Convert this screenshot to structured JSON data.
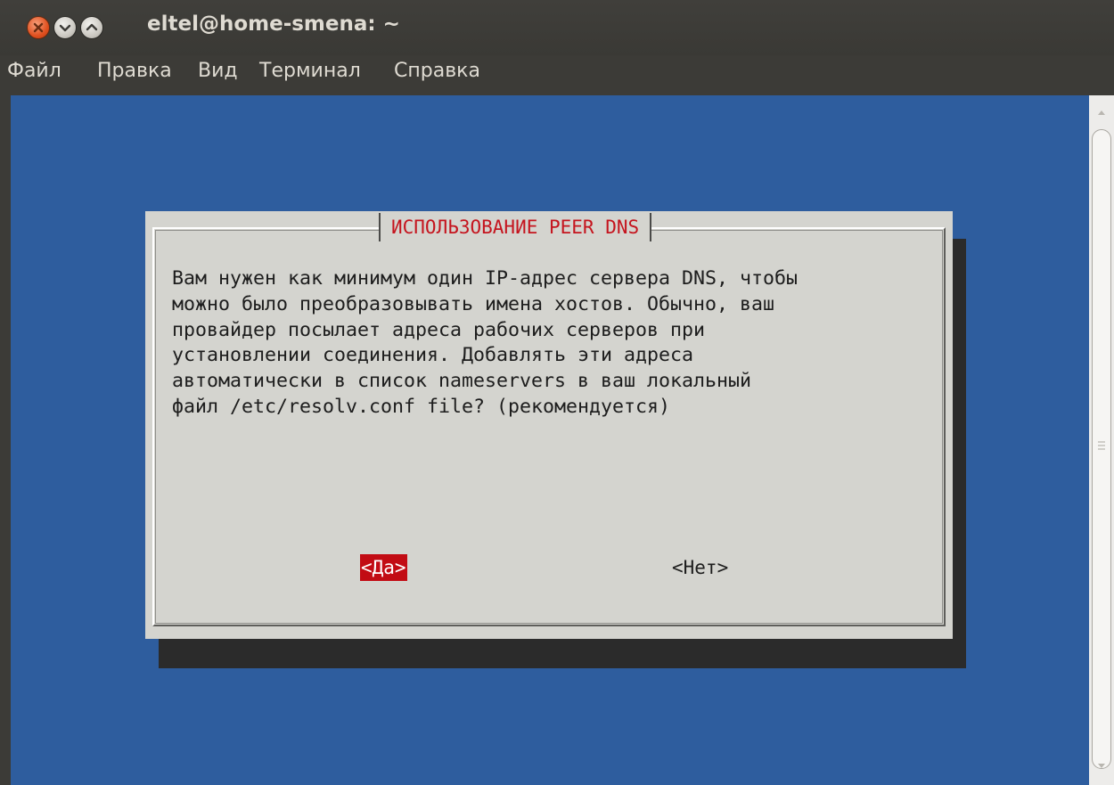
{
  "window": {
    "title": "eltel@home-smena: ~"
  },
  "menu": {
    "items": [
      {
        "label": "Файл"
      },
      {
        "label": "Правка"
      },
      {
        "label": "Вид"
      },
      {
        "label": "Терминал"
      },
      {
        "label": "Справка"
      }
    ]
  },
  "dialog": {
    "title": "ИСПОЛЬЗОВАНИЕ PEER DNS",
    "text": "Вам нужен как минимум один IP-адрес сервера DNS, чтобы\nможно было преобразовывать имена хостов. Обычно, ваш\nпровайдер посылает адреса рабочих серверов при\nустановлении соединения. Добавлять эти адреса\nавтоматически в список nameservers в ваш локальный\nфайл /etc/resolv.conf file? (рекомендуется)",
    "yes_label": "<Да>",
    "no_label": "<Нет>"
  },
  "colors": {
    "terminal_background": "#2e5d9e",
    "dialog_background": "#d4d4cf",
    "title_text": "#c5141e",
    "selected_button": "#c20c14",
    "window_chrome": "#3c3b37"
  },
  "icons": {
    "close": "close-icon",
    "minimize": "minimize-icon",
    "maximize": "maximize-icon",
    "scroll_up": "scroll-up-arrow-icon",
    "scroll_down": "scroll-down-arrow-icon"
  }
}
